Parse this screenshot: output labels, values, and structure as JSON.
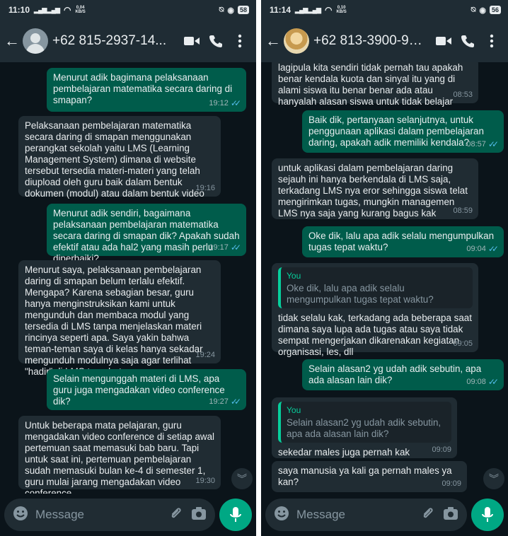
{
  "left": {
    "status": {
      "time": "11:10",
      "speed": "0,04",
      "speed_unit": "KB/S",
      "battery": "58"
    },
    "contact": "+62 815-2937-14...",
    "messages": [
      {
        "dir": "out",
        "text": "Menurut adik bagimana pelaksanaan pembelajaran matematika secara daring di smapan?",
        "time": "19:12"
      },
      {
        "dir": "in",
        "text": "Pelaksanaan pembelajaran matematika secara daring di smapan menggunakan perangkat sekolah yaitu LMS (Learning Management System) dimana di website tersebut tersedia materi-materi yang telah diupload oleh guru baik dalam bentuk dokumen (modul) atau dalam bentuk video",
        "time": "19:16"
      },
      {
        "dir": "out",
        "text": "Menurut adik sendiri, bagaimana pelaksanaan pembelajaran matematika secara daring di smapan dik? Apakah sudah efektif atau ada hal2 yang masih perlu diperbaiki?",
        "time": "19:17"
      },
      {
        "dir": "in",
        "text": "Menurut saya, pelaksanaan pembelajaran daring di smapan belum terlalu efektif. Mengapa? Karena sebagian besar, guru hanya menginstruksikan kami untuk mengunduh dan membaca modul yang tersedia di LMS tanpa menjelaskan materi rincinya seperti apa. Saya yakin bahwa teman-teman saya di kelas hanya sekadar mengunduh modulnya saja agar terlihat \"hadir\" di LMS tersebut.",
        "time": "19:24"
      },
      {
        "dir": "out",
        "text": "Selain mengunggah materi di LMS, apa guru juga mengadakan video conference dik?",
        "time": "19:27"
      },
      {
        "dir": "in",
        "text": "Untuk beberapa mata pelajaran, guru mengadakan video conference di setiap awal pertemuan saat memasuki bab baru. Tapi untuk saat ini, pertemuan pembelajaran sudah memasuki bulan ke-4 di semester 1, guru mulai jarang mengadakan video conference",
        "time": "19:30"
      }
    ]
  },
  "right": {
    "status": {
      "time": "11:14",
      "speed": "0,10",
      "speed_unit": "KB/S",
      "battery": "56"
    },
    "contact": "+62 813-3900-91...",
    "messages": [
      {
        "dir": "in",
        "text": "lagipula kita sendiri tidak pernah tau apakah benar kendala kuota dan sinyal itu yang di alami siswa itu benar benar ada atau hanyalah alasan siswa untuk tidak belajar",
        "time": "08:53"
      },
      {
        "dir": "out",
        "text": "Baik dik, pertanyaan selanjutnya, untuk penggunaan aplikasi dalam pembelajaran daring, apakah adik memiliki kendala?",
        "time": "08:57"
      },
      {
        "dir": "in",
        "text": "untuk aplikasi dalam pembelajaran daring sejauh ini hanya berkendala di LMS saja, terkadang LMS nya eror sehingga siswa telat mengirimkan tugas, mungkin managemen LMS nya saja yang kurang bagus kak",
        "time": "08:59"
      },
      {
        "dir": "out",
        "text": "Oke dik, lalu apa adik selalu mengumpulkan tugas tepat waktu?",
        "time": "09:04"
      },
      {
        "dir": "in",
        "quote_author": "You",
        "quote": "Oke dik, lalu apa adik selalu mengumpulkan tugas tepat waktu?",
        "text": "tidak selalu kak, terkadang ada beberapa saat dimana saya lupa ada tugas atau saya tidak sempat mengerjakan dikarenakan kegiatan organisasi, les, dll",
        "time": "09:05"
      },
      {
        "dir": "out",
        "text": "Selain alasan2 yg udah adik sebutin, apa ada alasan lain dik?",
        "time": "09:08"
      },
      {
        "dir": "in",
        "quote_author": "You",
        "quote": "Selain alasan2 yg udah adik sebutin, apa ada alasan lain dik?",
        "text": "sekedar males juga pernah kak",
        "time": "09:09"
      },
      {
        "dir": "in",
        "text": "saya manusia ya kali ga pernah males ya kan?",
        "time": "09:09"
      }
    ]
  },
  "composer": {
    "placeholder": "Message"
  },
  "icons": {
    "back": "arrow-left",
    "video": "video-camera",
    "call": "phone",
    "menu": "more-vertical",
    "emoji": "smiley",
    "attach": "paperclip",
    "camera": "camera",
    "mic": "microphone",
    "scroll": "chevron-double-down",
    "read": "double-check-blue"
  },
  "colors": {
    "header": "#1f2c34",
    "background": "#0b141a",
    "incoming": "#202c33",
    "outgoing": "#005c4b",
    "accent": "#00a884",
    "read_ticks": "#53bdeb"
  }
}
